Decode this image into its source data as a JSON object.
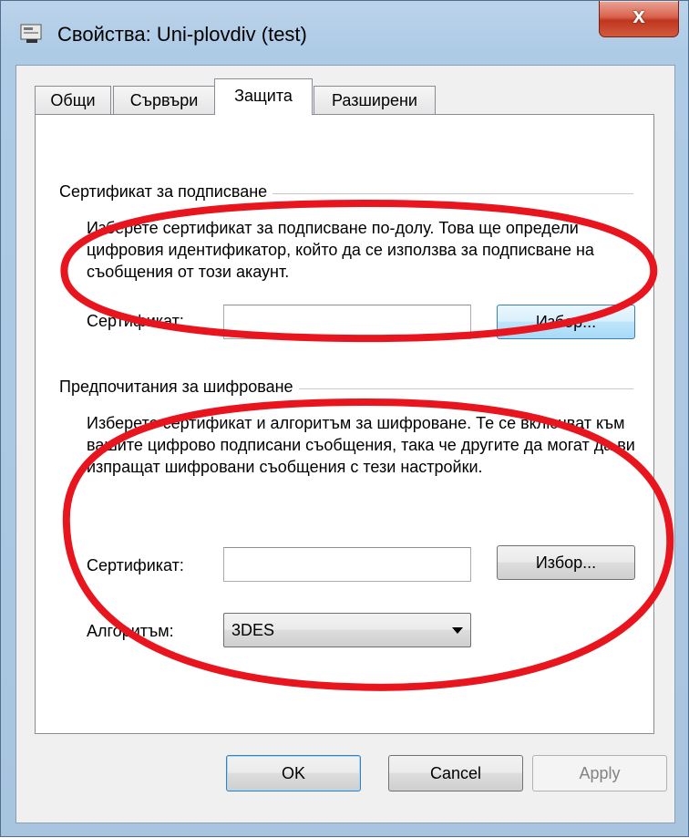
{
  "window": {
    "title": "Свойства: Uni-plovdiv (test)",
    "close_symbol": "x"
  },
  "tabs": [
    {
      "label": "Общи",
      "active": false
    },
    {
      "label": "Сървъри",
      "active": false
    },
    {
      "label": "Защита",
      "active": true
    },
    {
      "label": "Разширени",
      "active": false
    }
  ],
  "signing": {
    "group_label": "Сертификат за подписване",
    "description": "Изберете сертификат за подписване по-долу. Това ще определи цифровия идентификатор, който да се използва за подписване на съобщения от този акаунт.",
    "certificate_label": "Сертификат:",
    "certificate_value": "",
    "choose_button": "Избор..."
  },
  "encryption": {
    "group_label": "Предпочитания за шифроване",
    "description": "Изберете сертификат и алгоритъм за шифроване. Те се включват към вашите цифрово подписани съобщения, така че другите да могат да ви изпращат шифровани съобщения с тези настройки.",
    "certificate_label": "Сертификат:",
    "certificate_value": "",
    "choose_button": "Избор...",
    "algorithm_label": "Алгоритъм:",
    "algorithm_value": "3DES"
  },
  "footer": {
    "ok": "OK",
    "cancel": "Cancel",
    "apply": "Apply"
  },
  "colors": {
    "annotation": "#e8141e",
    "titlebar": "#aecbe6",
    "close_button": "#c0361f"
  }
}
